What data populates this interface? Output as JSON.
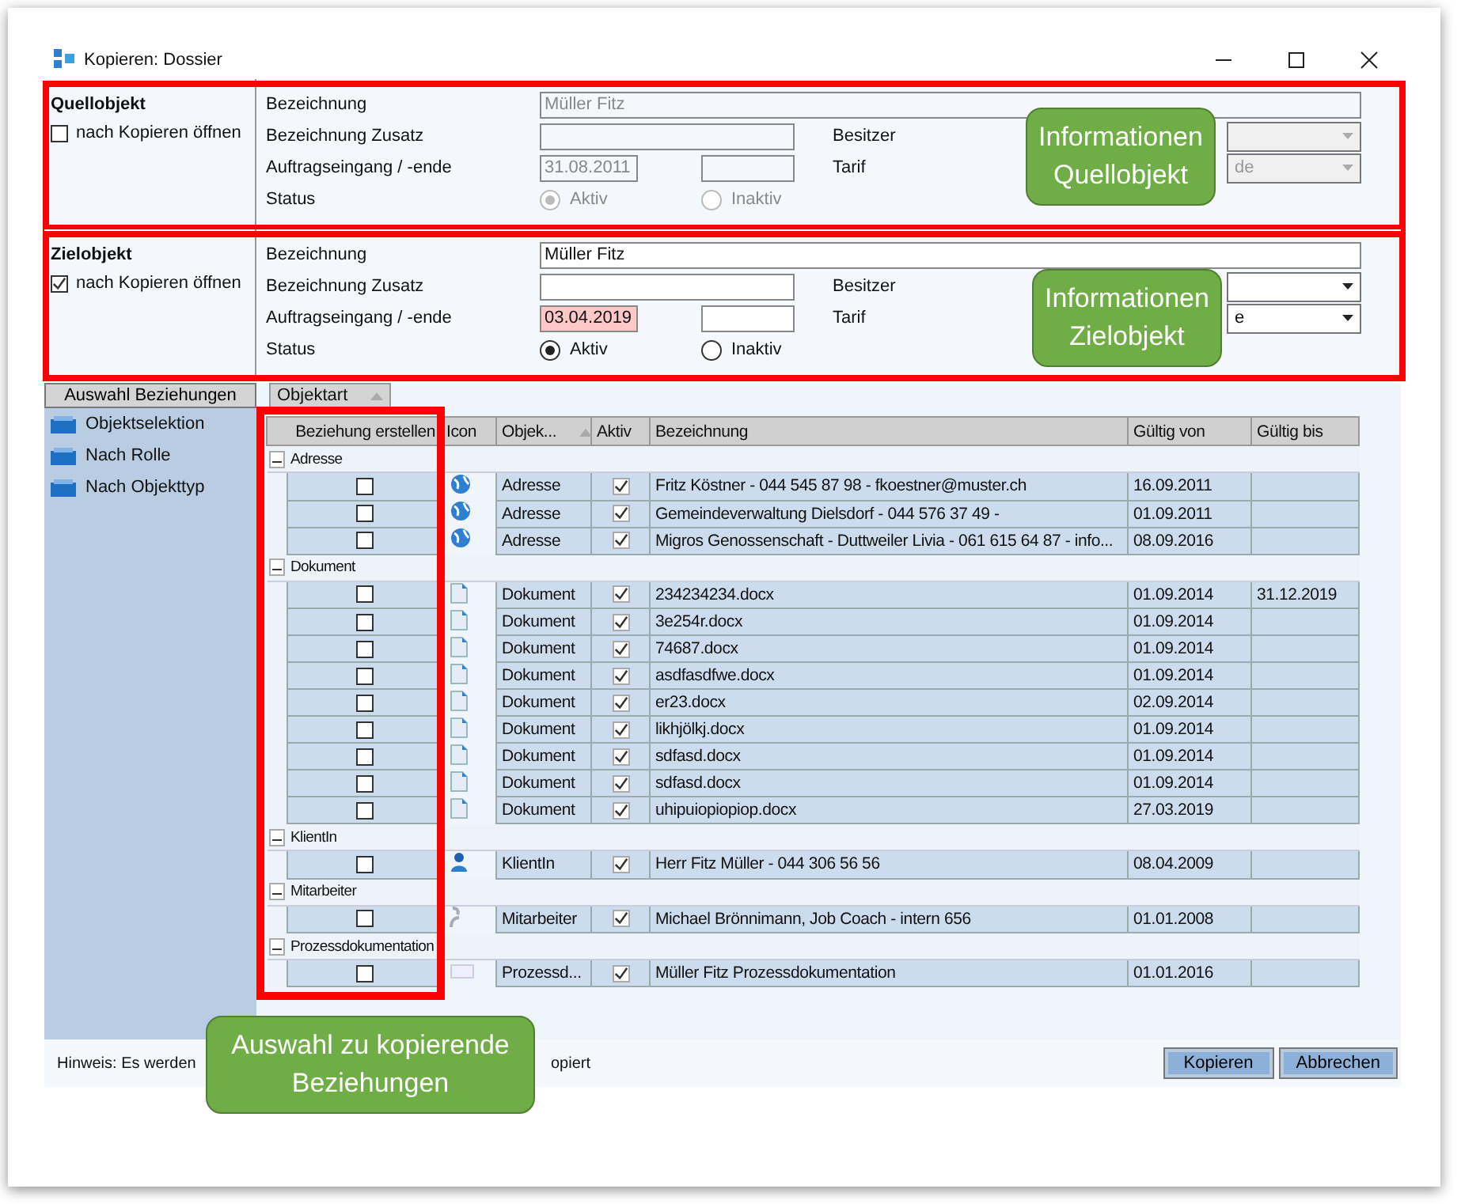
{
  "window": {
    "title": "Kopieren: Dossier"
  },
  "sections": [
    {
      "title": "Quellobjekt",
      "disabled": true,
      "open_after_copy": {
        "label": "nach Kopieren öffnen",
        "checked": false
      },
      "labels": [
        "Bezeichnung",
        "Bezeichnung Zusatz",
        "Auftragseingang / -ende",
        "Status"
      ],
      "name_value": "Müller Fitz",
      "start_date": "31.08.2011",
      "start_date_highlighted": false,
      "owner_label": "Besitzer",
      "tariff_label": "Tarif",
      "tariff_value": "de",
      "status_options": [
        {
          "label": "Aktiv",
          "selected": true
        },
        {
          "label": "Inaktiv",
          "selected": false
        }
      ],
      "callout": "Informationen Quellobjekt"
    },
    {
      "title": "Zielobjekt",
      "disabled": false,
      "open_after_copy": {
        "label": "nach Kopieren öffnen",
        "checked": true
      },
      "labels": [
        "Bezeichnung",
        "Bezeichnung Zusatz",
        "Auftragseingang / -ende",
        "Status"
      ],
      "name_value": "Müller Fitz",
      "start_date": "03.04.2019",
      "start_date_highlighted": true,
      "owner_label": "Besitzer",
      "tariff_label": "Tarif",
      "tariff_value": "e",
      "status_options": [
        {
          "label": "Aktiv",
          "selected": true
        },
        {
          "label": "Inaktiv",
          "selected": false
        }
      ],
      "callout": "Informationen Zielobjekt"
    }
  ],
  "sidebar": {
    "header": "Auswahl Beziehungen",
    "items": [
      {
        "label": "Objektselektion"
      },
      {
        "label": "Nach Rolle"
      },
      {
        "label": "Nach Objekttyp"
      }
    ]
  },
  "grid": {
    "group_tab": "Objektart",
    "columns": [
      "Beziehung erstellen",
      "Icon",
      "Objek...",
      "Aktiv",
      "Bezeichnung",
      "Gültig von",
      "Gültig bis"
    ],
    "callout": "Auswahl zu kopierende Beziehungen",
    "groups": [
      {
        "name": "Adresse",
        "expanded": true,
        "rows": [
          {
            "kind": "address",
            "create": false,
            "type": "Adresse",
            "active": true,
            "name": "Fritz Köstner -  044 545 87 98 - fkoestner@muster.ch",
            "from": "16.09.2011"
          },
          {
            "kind": "address",
            "create": false,
            "type": "Adresse",
            "active": true,
            "name": "Gemeindeverwaltung Dielsdorf -  044 576 37 49 -",
            "from": "01.09.2011"
          },
          {
            "kind": "address",
            "create": false,
            "type": "Adresse",
            "active": true,
            "name": "Migros Genossenschaft -  Duttweiler Livia -  061 615 64 87 - info...",
            "from": "08.09.2016"
          }
        ]
      },
      {
        "name": "Dokument",
        "expanded": true,
        "rows": [
          {
            "kind": "document",
            "create": false,
            "type": "Dokument",
            "active": true,
            "name": "234234234.docx",
            "from": "01.09.2014",
            "to": "31.12.2019"
          },
          {
            "kind": "document",
            "create": false,
            "type": "Dokument",
            "active": true,
            "name": "3e254r.docx",
            "from": "01.09.2014"
          },
          {
            "kind": "document",
            "create": false,
            "type": "Dokument",
            "active": true,
            "name": "74687.docx",
            "from": "01.09.2014"
          },
          {
            "kind": "document",
            "create": false,
            "type": "Dokument",
            "active": true,
            "name": "asdfasdfwe.docx",
            "from": "01.09.2014"
          },
          {
            "kind": "document",
            "create": false,
            "type": "Dokument",
            "active": true,
            "name": "er23.docx",
            "from": "02.09.2014"
          },
          {
            "kind": "document",
            "create": false,
            "type": "Dokument",
            "active": true,
            "name": "likhjölkj.docx",
            "from": "01.09.2014"
          },
          {
            "kind": "document",
            "create": false,
            "type": "Dokument",
            "active": true,
            "name": "sdfasd.docx",
            "from": "01.09.2014"
          },
          {
            "kind": "document",
            "create": false,
            "type": "Dokument",
            "active": true,
            "name": "sdfasd.docx",
            "from": "01.09.2014"
          },
          {
            "kind": "document",
            "create": false,
            "type": "Dokument",
            "active": true,
            "name": "uhipuiopiopiop.docx",
            "from": "27.03.2019"
          }
        ]
      },
      {
        "name": "KlientIn",
        "expanded": true,
        "rows": [
          {
            "kind": "client",
            "create": false,
            "type": "KlientIn",
            "active": true,
            "name": "Herr Fitz Müller -  044 306 56 56",
            "from": "08.04.2009"
          }
        ]
      },
      {
        "name": "Mitarbeiter",
        "expanded": true,
        "rows": [
          {
            "kind": "employee",
            "create": false,
            "type": "Mitarbeiter",
            "active": true,
            "name": "Michael Brönnimann,  Job Coach - intern 656",
            "from": "01.01.2008"
          }
        ]
      },
      {
        "name": "Prozessdokumentation",
        "expanded": true,
        "rows": [
          {
            "kind": "process",
            "create": false,
            "type": "Prozessd...",
            "active": true,
            "name": "Müller Fitz Prozessdokumentation",
            "from": "01.01.2016"
          }
        ]
      }
    ]
  },
  "footer": {
    "hint_parts": [
      "Hinweis: Es werden",
      "opiert"
    ],
    "buttons": [
      "Kopieren",
      "Abbrechen"
    ]
  }
}
